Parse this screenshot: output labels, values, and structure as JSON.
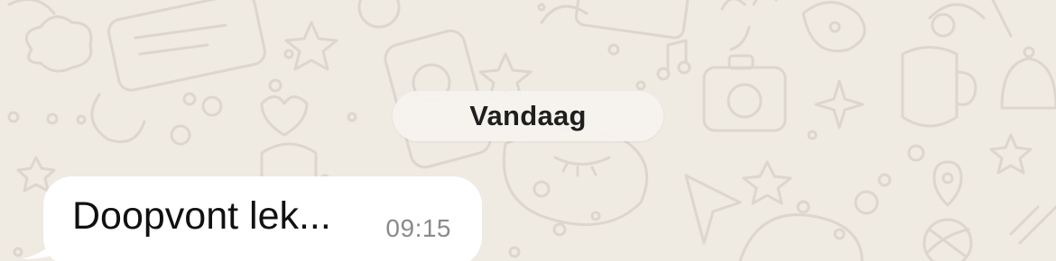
{
  "chat": {
    "date_separator": "Vandaag",
    "messages": [
      {
        "text": "Doopvont lek...",
        "time": "09:15",
        "direction": "incoming"
      }
    ]
  },
  "colors": {
    "wallpaper": "#efeae2",
    "doodle": "#ddd6cc",
    "bubble_incoming": "#ffffff",
    "timestamp": "#8a8a8a"
  }
}
